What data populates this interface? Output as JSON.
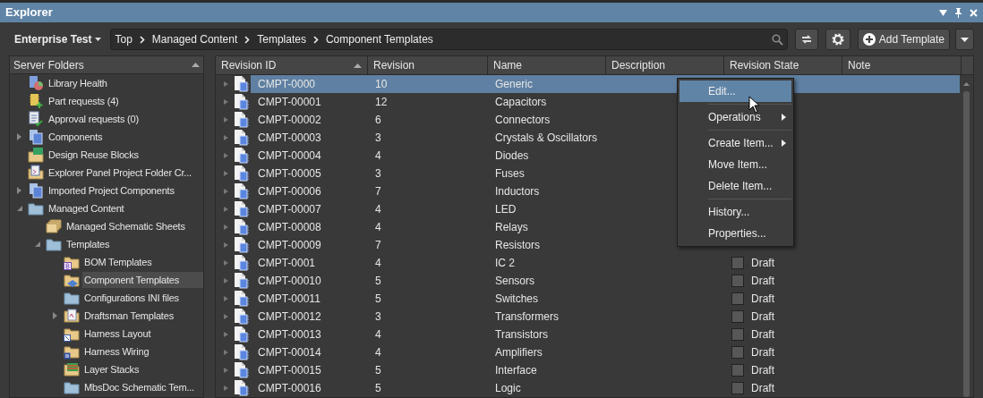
{
  "window": {
    "title": "Explorer"
  },
  "toolbar": {
    "server": "Enterprise Test",
    "breadcrumb": [
      "Top",
      "Managed Content",
      "Templates",
      "Component Templates"
    ],
    "add_button": "Add Template"
  },
  "sidebar": {
    "title": "Server Folders",
    "items": [
      {
        "label": "Library Health",
        "kind": "health",
        "selected": false
      },
      {
        "label": "Part requests (4)",
        "kind": "request",
        "selected": false
      },
      {
        "label": "Approval requests (0)",
        "kind": "approval",
        "selected": false
      },
      {
        "label": "Components",
        "kind": "components",
        "selected": false,
        "expanded": false
      },
      {
        "label": "Design Reuse Blocks",
        "kind": "reuse",
        "selected": false
      },
      {
        "label": "Explorer Panel Project Folder Cr...",
        "kind": "project",
        "selected": false
      },
      {
        "label": "Imported Project Components",
        "kind": "components",
        "selected": false,
        "expanded": false
      },
      {
        "label": "Managed Content",
        "kind": "folder",
        "selected": false,
        "expanded": true,
        "children": [
          {
            "label": "Managed Schematic Sheets",
            "kind": "sheets",
            "selected": false
          },
          {
            "label": "Templates",
            "kind": "folder",
            "selected": false,
            "expanded": true,
            "children": [
              {
                "label": "BOM Templates",
                "kind": "bom",
                "selected": false
              },
              {
                "label": "Component Templates",
                "kind": "template",
                "selected": true
              },
              {
                "label": "Configurations INI files",
                "kind": "folder",
                "selected": false
              },
              {
                "label": "Draftsman Templates",
                "kind": "draftsman",
                "selected": false,
                "expanded": false
              },
              {
                "label": "Harness Layout",
                "kind": "harness",
                "selected": false
              },
              {
                "label": "Harness Wiring",
                "kind": "wiring",
                "selected": false
              },
              {
                "label": "Layer Stacks",
                "kind": "layers",
                "selected": false
              },
              {
                "label": "MbsDoc Schematic Tem...",
                "kind": "folder",
                "selected": false
              }
            ]
          }
        ]
      }
    ]
  },
  "table": {
    "columns": [
      {
        "label": "Revision ID",
        "sorted": true
      },
      {
        "label": "Revision",
        "sorted": false
      },
      {
        "label": "Name",
        "sorted": false
      },
      {
        "label": "Description",
        "sorted": false
      },
      {
        "label": "Revision State",
        "sorted": false
      },
      {
        "label": "Note",
        "sorted": false
      }
    ],
    "rows": [
      {
        "id": "CMPT-0000",
        "revision": "10",
        "name": "Generic",
        "selected": true
      },
      {
        "id": "CMPT-00001",
        "revision": "12",
        "name": "Capacitors",
        "selected": false
      },
      {
        "id": "CMPT-00002",
        "revision": "6",
        "name": "Connectors",
        "selected": false
      },
      {
        "id": "CMPT-00003",
        "revision": "3",
        "name": "Crystals & Oscillators",
        "selected": false
      },
      {
        "id": "CMPT-00004",
        "revision": "4",
        "name": "Diodes",
        "selected": false
      },
      {
        "id": "CMPT-00005",
        "revision": "3",
        "name": "Fuses",
        "selected": false
      },
      {
        "id": "CMPT-00006",
        "revision": "7",
        "name": "Inductors",
        "selected": false
      },
      {
        "id": "CMPT-00007",
        "revision": "4",
        "name": "LED",
        "selected": false
      },
      {
        "id": "CMPT-00008",
        "revision": "4",
        "name": "Relays",
        "selected": false
      },
      {
        "id": "CMPT-00009",
        "revision": "7",
        "name": "Resistors",
        "selected": false
      },
      {
        "id": "CMPT-0001",
        "revision": "4",
        "name": "IC 2",
        "state": "Draft",
        "selected": false
      },
      {
        "id": "CMPT-00010",
        "revision": "5",
        "name": "Sensors",
        "state": "Draft",
        "selected": false
      },
      {
        "id": "CMPT-00011",
        "revision": "5",
        "name": "Switches",
        "state": "Draft",
        "selected": false
      },
      {
        "id": "CMPT-00012",
        "revision": "3",
        "name": "Transformers",
        "state": "Draft",
        "selected": false
      },
      {
        "id": "CMPT-00013",
        "revision": "4",
        "name": "Transistors",
        "state": "Draft",
        "selected": false
      },
      {
        "id": "CMPT-00014",
        "revision": "4",
        "name": "Amplifiers",
        "state": "Draft",
        "selected": false
      },
      {
        "id": "CMPT-00015",
        "revision": "5",
        "name": "Interface",
        "state": "Draft",
        "selected": false
      },
      {
        "id": "CMPT-00016",
        "revision": "5",
        "name": "Logic",
        "state": "Draft",
        "selected": false
      }
    ]
  },
  "context_menu": {
    "groups": [
      [
        {
          "label": "Edit...",
          "selected": true,
          "submenu": false
        }
      ],
      [
        {
          "label": "Operations",
          "selected": false,
          "submenu": true
        }
      ],
      [
        {
          "label": "Create Item...",
          "selected": false,
          "submenu": true
        },
        {
          "label": "Move Item...",
          "selected": false,
          "submenu": false
        },
        {
          "label": "Delete Item...",
          "selected": false,
          "submenu": false
        }
      ],
      [
        {
          "label": "History...",
          "selected": false,
          "submenu": false
        },
        {
          "label": "Properties...",
          "selected": false,
          "submenu": false
        }
      ]
    ]
  }
}
